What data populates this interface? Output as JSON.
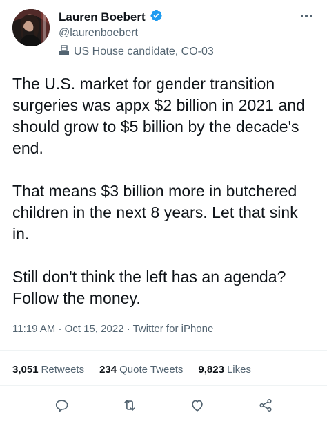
{
  "user": {
    "display_name": "Lauren Boebert",
    "handle": "@laurenboebert",
    "label": "US House candidate, CO-03",
    "verified": true
  },
  "tweet": {
    "text": "The U.S. market for gender transition surgeries was appx $2 billion in 2021 and should grow to $5 billion by the decade's end.\n\nThat means $3 billion more in butchered children in the next 8 years. Let that sink in.\n\nStill don't think the left has an agenda? Follow the money.",
    "time": "11:19 AM",
    "date": "Oct 15, 2022",
    "source": "Twitter for iPhone",
    "separator": "·"
  },
  "stats": {
    "retweets_count": "3,051",
    "retweets_label": "Retweets",
    "quotes_count": "234",
    "quotes_label": "Quote Tweets",
    "likes_count": "9,823",
    "likes_label": "Likes"
  },
  "icons": {
    "verified": "verified-badge-icon",
    "label": "government-building-icon",
    "more": "more-options-icon",
    "reply": "reply-icon",
    "retweet": "retweet-icon",
    "like": "heart-icon",
    "share": "share-icon"
  },
  "colors": {
    "verified_blue": "#1d9bf0",
    "secondary_text": "#536471",
    "primary_text": "#0f1419"
  }
}
